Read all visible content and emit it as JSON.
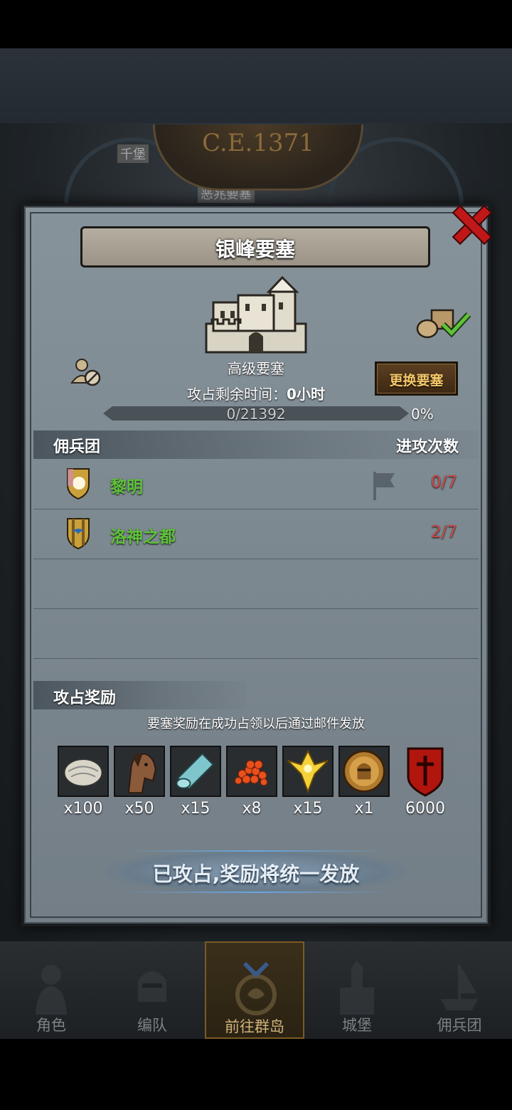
{
  "map": {
    "era": "C.E.1371",
    "labels": [
      "千堡",
      "恶兆要塞"
    ]
  },
  "dialog": {
    "title": "银峰要塞",
    "fort_type": "高级要塞",
    "timer_label": "攻占剩余时间：",
    "timer_value": "0小时",
    "progress_text": "0/21392",
    "progress_pct": "0%",
    "progress_fraction": 0,
    "swap_button": "更换要塞",
    "mercenary_header": "佣兵团",
    "attacks_header": "进攻次数",
    "rows": [
      {
        "name": "黎明",
        "count": "0/7"
      },
      {
        "name": "洛神之都",
        "count": "2/7"
      }
    ],
    "reward_header": "攻占奖励",
    "reward_note": "要塞奖励在成功占领以后通过邮件发放",
    "rewards": [
      {
        "icon": "oyster-icon",
        "qty": "x100"
      },
      {
        "icon": "horse-icon",
        "qty": "x50"
      },
      {
        "icon": "cloth-roll-icon",
        "qty": "x15"
      },
      {
        "icon": "roe-icon",
        "qty": "x8"
      },
      {
        "icon": "gold-crest-icon",
        "qty": "x15"
      },
      {
        "icon": "knight-medal-icon",
        "qty": "x1"
      },
      {
        "icon": "banner-emblem-icon",
        "qty": "6000"
      }
    ],
    "claimed_text": "已攻占,奖励将统一发放"
  },
  "nav": [
    {
      "label": "角色",
      "icon": "knight-icon"
    },
    {
      "label": "编队",
      "icon": "helmet-icon"
    },
    {
      "label": "前往群岛",
      "icon": "compass-icon"
    },
    {
      "label": "城堡",
      "icon": "castle-icon"
    },
    {
      "label": "佣兵团",
      "icon": "ship-icon"
    }
  ],
  "colors": {
    "accent_green": "#5fc23a",
    "count_red": "#d04848",
    "close_red": "#c01818",
    "swap_gold": "#f5c86a"
  }
}
